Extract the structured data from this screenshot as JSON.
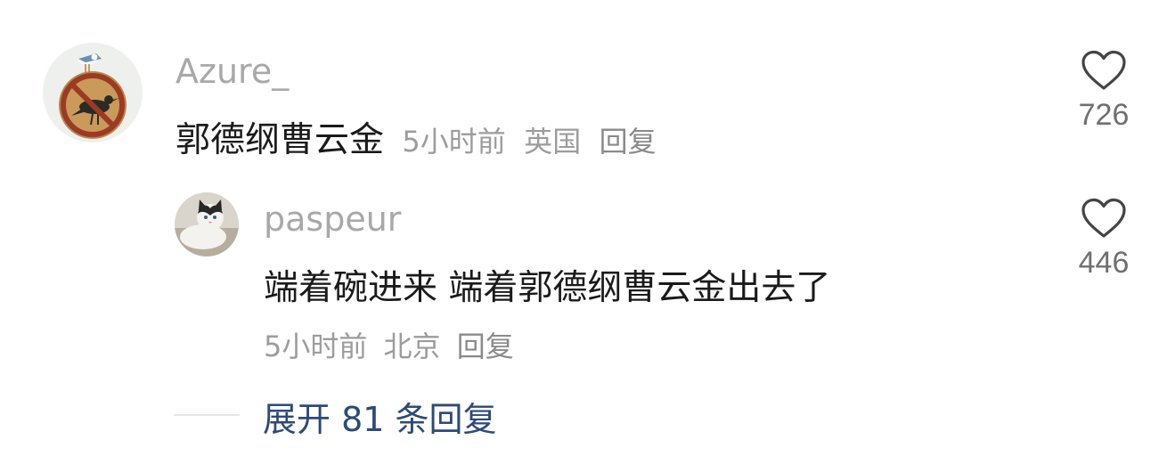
{
  "comments": [
    {
      "username": "Azure_",
      "text": "郭德纲曹云金",
      "time": "5小时前",
      "location": "英国",
      "reply_label": "回复",
      "likes": "726",
      "avatar_icon": "seagull-no-bird-sign-avatar",
      "like_icon": "heart-outline-icon"
    },
    {
      "username": "paspeur",
      "text": "端着碗进来 端着郭德纲曹云金出去了",
      "time": "5小时前",
      "location": "北京",
      "reply_label": "回复",
      "likes": "446",
      "avatar_icon": "cat-photo-avatar",
      "like_icon": "heart-outline-icon"
    }
  ],
  "expand_replies_label": "展开 81 条回复",
  "colors": {
    "username": "#a8a8a8",
    "body_text": "#1a1a1a",
    "meta": "#9c9c9c",
    "link": "#2c4a78"
  }
}
